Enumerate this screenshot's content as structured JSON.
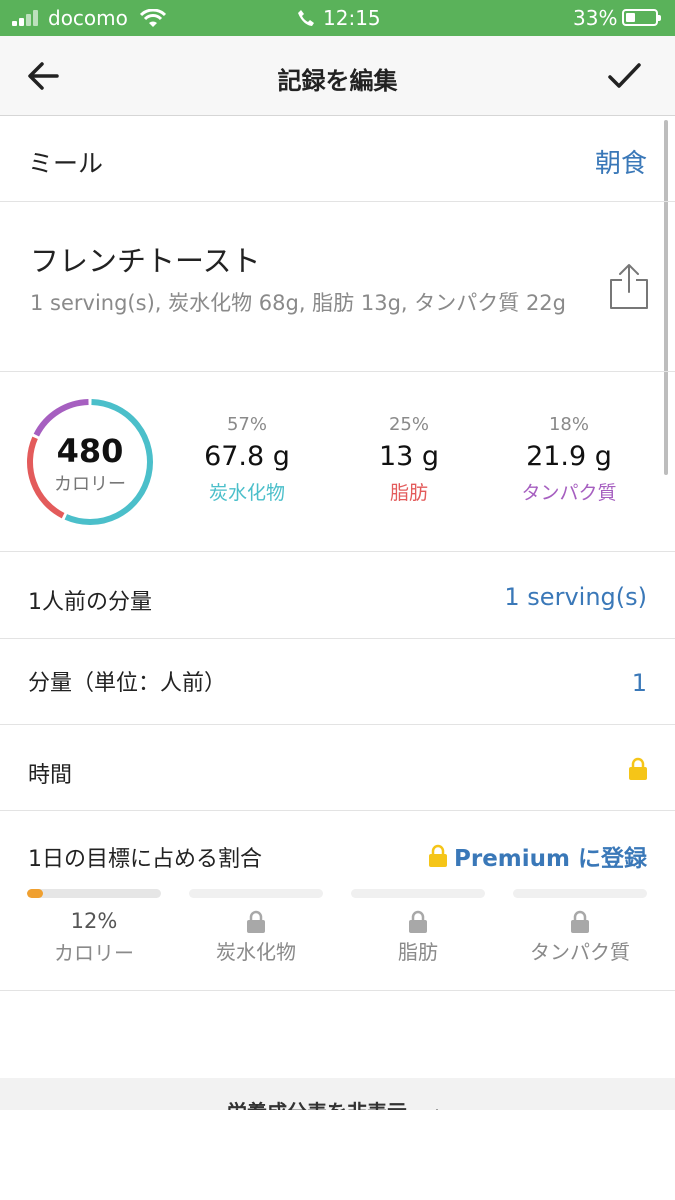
{
  "status_bar": {
    "carrier": "docomo",
    "time": "12:15",
    "battery": "33%",
    "battery_level": 0.33
  },
  "nav": {
    "title": "記録を編集",
    "back_icon": "arrow-left-icon",
    "confirm_icon": "checkmark-icon"
  },
  "meal": {
    "label": "ミール",
    "value": "朝食"
  },
  "food": {
    "name": "フレンチトースト",
    "description": "1 serving(s), 炭水化物 68g, 脂肪 13g, タンパク質 22g",
    "share_icon": "share-icon"
  },
  "summary": {
    "calories": "480",
    "calories_label": "カロリー",
    "macros": [
      {
        "pct": "57%",
        "value": "67.8 g",
        "name": "炭水化物",
        "color": "#4bbfca",
        "fraction": 0.57
      },
      {
        "pct": "25%",
        "value": "13 g",
        "name": "脂肪",
        "color": "#e35b5b",
        "fraction": 0.25
      },
      {
        "pct": "18%",
        "value": "21.9 g",
        "name": "タンパク質",
        "color": "#a65fc0",
        "fraction": 0.18
      }
    ]
  },
  "serving_size": {
    "label": "1人前の分量",
    "value": "1 serving(s)"
  },
  "quantity": {
    "label": "分量（単位：人前）",
    "value": "1"
  },
  "time_row": {
    "label": "時間",
    "lock_icon": "lock-icon"
  },
  "daily_goal": {
    "label": "1日の目標に占める割合",
    "premium_label": "Premium に登録",
    "items": [
      {
        "pct": "12%",
        "name": "カロリー",
        "fraction": 0.12,
        "locked": false
      },
      {
        "name": "炭水化物",
        "locked": true
      },
      {
        "name": "脂肪",
        "locked": true
      },
      {
        "name": "タンパク質",
        "locked": true
      }
    ]
  },
  "bottom": {
    "toggle_label": "栄養成分表を非表示"
  },
  "colors": {
    "status_bar": "#5ab25a",
    "link": "#3a78b8",
    "lock": "#f5c518",
    "goal_fill": "#f0a030"
  }
}
